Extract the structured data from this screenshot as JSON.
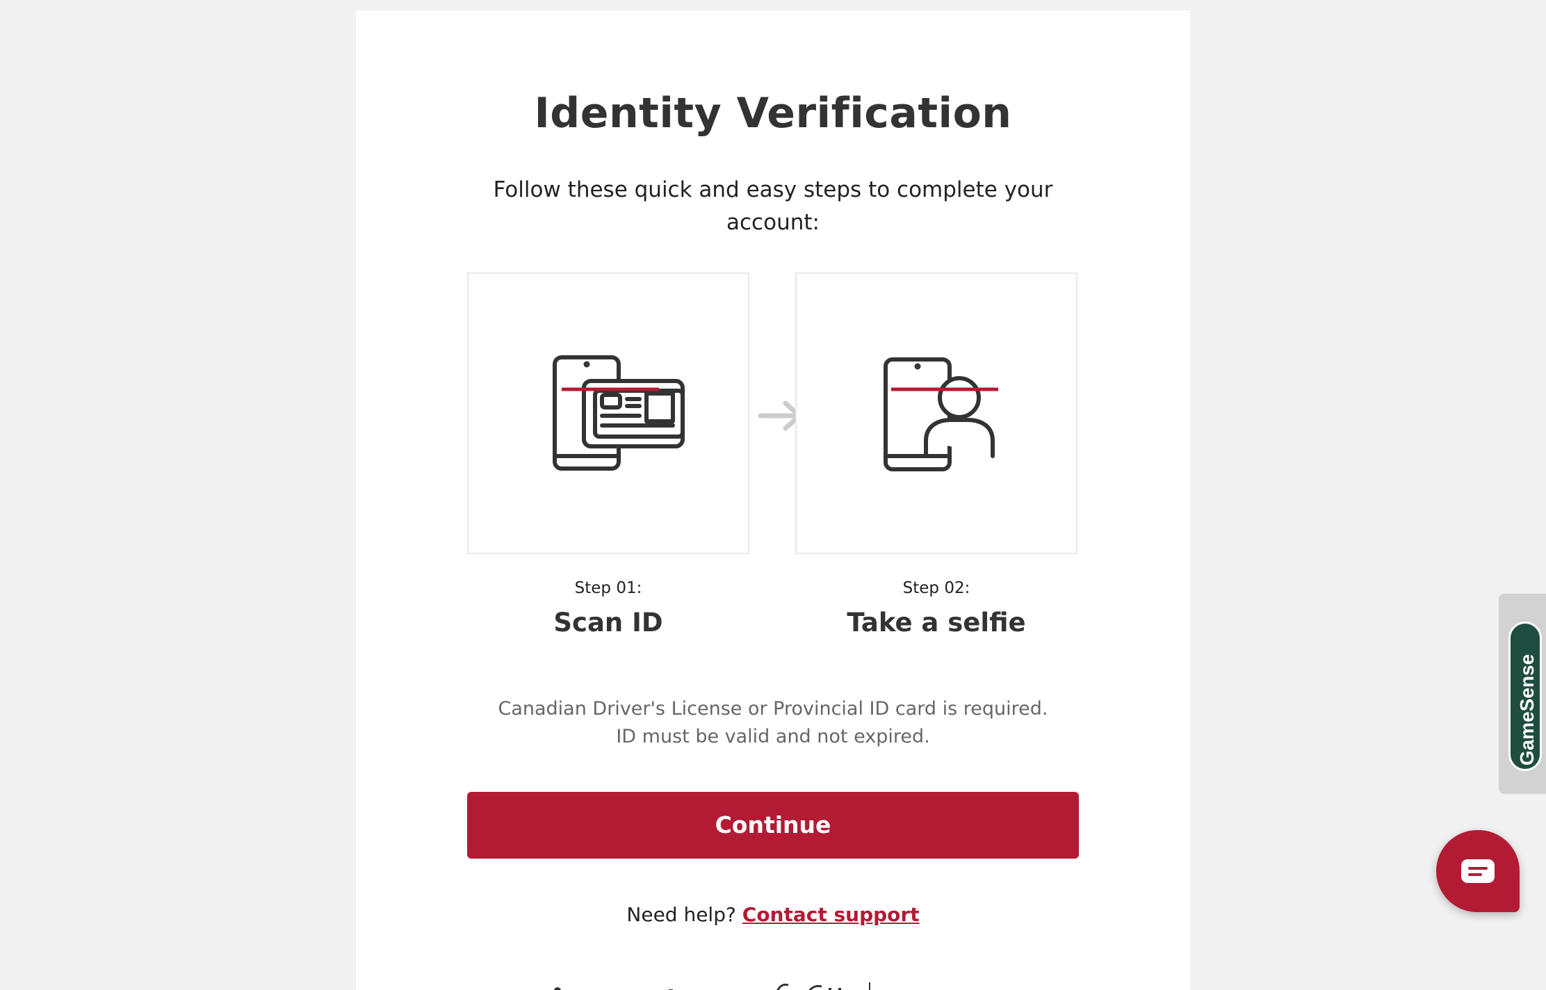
{
  "page": {
    "title": "Identity Verification",
    "subtitle": "Follow these quick and easy steps to complete your account:"
  },
  "steps": [
    {
      "label": "Step 01:",
      "title": "Scan ID",
      "icon": "phone-id-card-scan-icon"
    },
    {
      "label": "Step 02:",
      "title": "Take a selfie",
      "icon": "phone-selfie-scan-icon"
    }
  ],
  "requirements": {
    "line1": "Canadian Driver's License or Provincial ID card is required.",
    "line2": "ID must be valid and not expired."
  },
  "actions": {
    "continue_label": "Continue"
  },
  "help": {
    "prefix": "Need help?",
    "link_label": "Contact support"
  },
  "widgets": {
    "gamesense_label": "GameSense",
    "chat_icon": "chat-bubble-icon"
  },
  "colors": {
    "accent": "#b31b34",
    "gamesense": "#1f4d3f",
    "icon_stroke": "#333333",
    "arrow": "#cccccc"
  }
}
